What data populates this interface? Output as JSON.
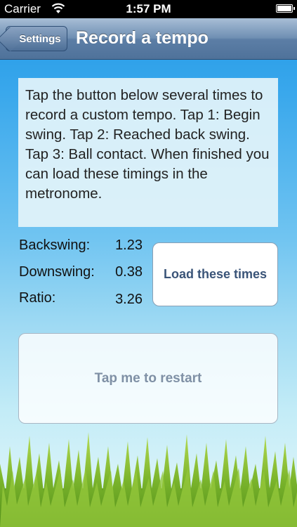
{
  "status_bar": {
    "carrier": "Carrier",
    "time": "1:57 PM"
  },
  "nav": {
    "back_label": "Settings",
    "title": "Record a tempo"
  },
  "instructions": "Tap the button below several times to record a custom tempo.  Tap 1: Begin swing.  Tap 2: Reached back swing.   Tap 3: Ball contact.  When finished you can load these timings in the metronome.",
  "stats": {
    "backswing": {
      "label": "Backswing:",
      "value": "1.23"
    },
    "downswing": {
      "label": "Downswing:",
      "value": "0.38"
    },
    "ratio": {
      "label": "Ratio:",
      "value": "3.26"
    }
  },
  "buttons": {
    "load": "Load these times",
    "restart": "Tap me to restart"
  },
  "colors": {
    "nav_bar": "#5c7ea6",
    "sky_top": "#1e97e6",
    "button_text": "#3a5478",
    "grass": "#7bb52c"
  },
  "icons": [
    "wifi-icon",
    "battery-icon",
    "back-arrow-icon"
  ]
}
